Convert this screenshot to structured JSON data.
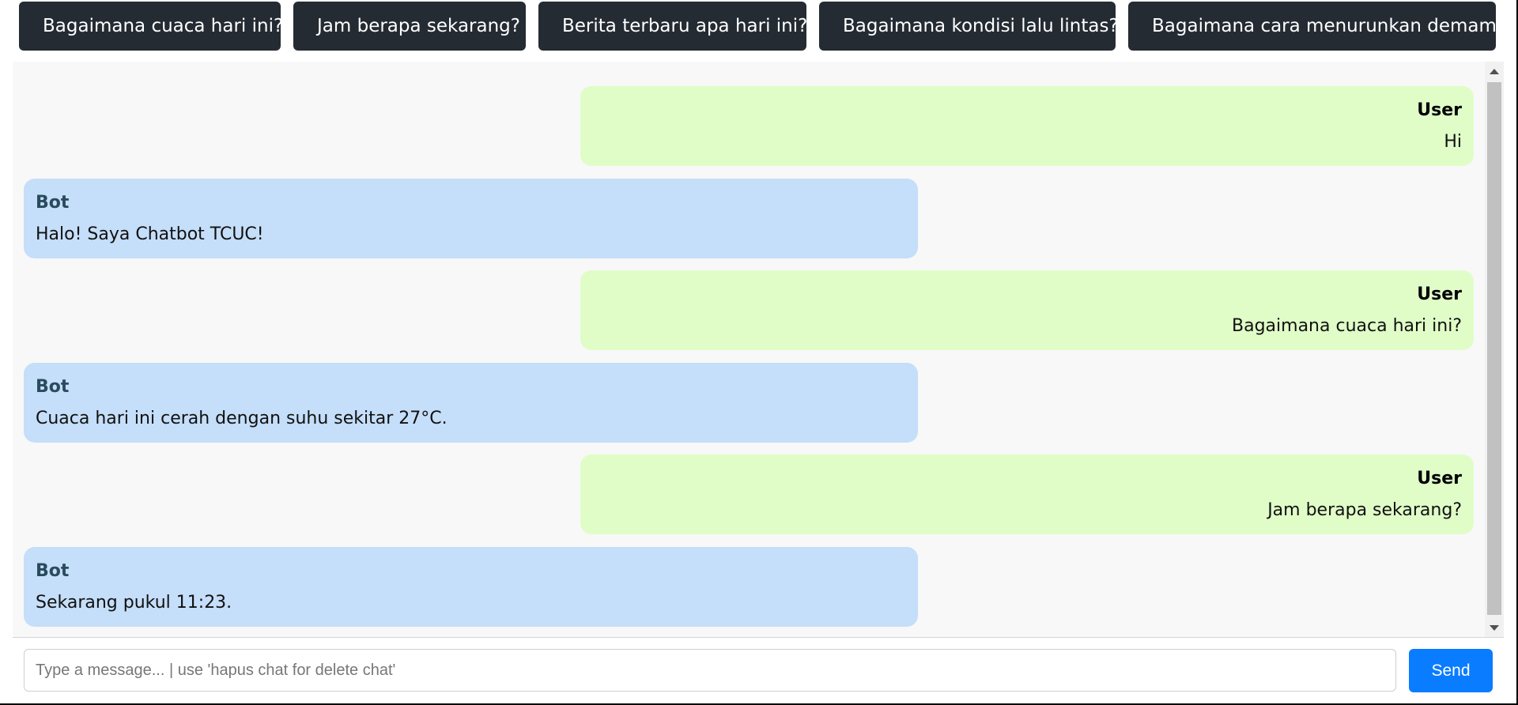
{
  "quick_questions": [
    "Bagaimana cuaca hari ini?",
    "Jam berapa sekarang?",
    "Berita terbaru apa hari ini?",
    "Bagaimana kondisi lalu lintas?",
    "Bagaimana cara menurunkan demam?"
  ],
  "messages": [
    {
      "sender": "User",
      "text": "Hi"
    },
    {
      "sender": "Bot",
      "text": "Halo! Saya Chatbot TCUC!"
    },
    {
      "sender": "User",
      "text": "Bagaimana cuaca hari ini?"
    },
    {
      "sender": "Bot",
      "text": "Cuaca hari ini cerah dengan suhu sekitar 27°C."
    },
    {
      "sender": "User",
      "text": "Jam berapa sekarang?"
    },
    {
      "sender": "Bot",
      "text": "Sekarang pukul 11:23."
    }
  ],
  "input": {
    "placeholder": "Type a message... | use 'hapus chat for delete chat'",
    "value": ""
  },
  "send_label": "Send",
  "colors": {
    "quick_button_bg": "#242b33",
    "user_bubble": "#e0fdc8",
    "bot_bubble": "#c5def9",
    "send_button": "#0a7cff",
    "chat_bg": "#f8f8f8"
  }
}
